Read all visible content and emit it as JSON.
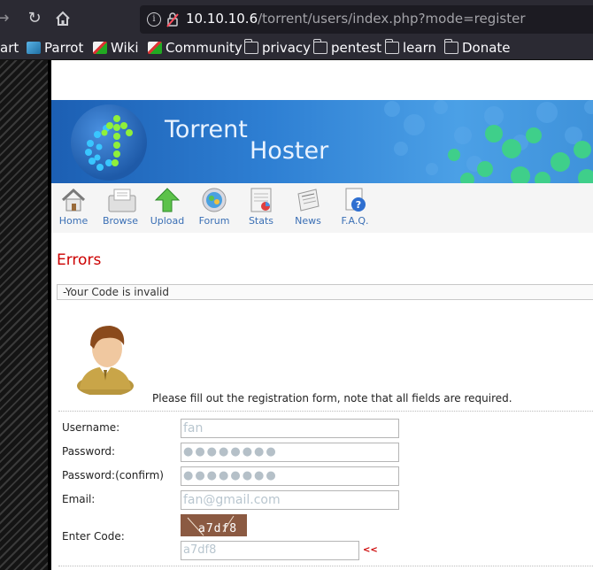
{
  "browser": {
    "url_host": "10.10.10.6",
    "url_path": "/torrent/users/index.php?mode=register",
    "bookmarks": [
      "art",
      "Parrot",
      "Wiki",
      "Community",
      "privacy",
      "pentest",
      "learn",
      "Donate"
    ]
  },
  "site": {
    "title_line1": "Torrent",
    "title_line2": "Hoster",
    "nav": [
      {
        "label": "Home",
        "icon": "home-icon"
      },
      {
        "label": "Browse",
        "icon": "browse-icon"
      },
      {
        "label": "Upload",
        "icon": "upload-icon"
      },
      {
        "label": "Forum",
        "icon": "forum-icon"
      },
      {
        "label": "Stats",
        "icon": "stats-icon"
      },
      {
        "label": "News",
        "icon": "news-icon"
      },
      {
        "label": "F.A.Q.",
        "icon": "faq-icon"
      }
    ]
  },
  "errors": {
    "title": "Errors",
    "message": "-Your Code is invalid"
  },
  "form": {
    "instructions": "Please fill out the registration form, note that all fields are required.",
    "username_label": "Username:",
    "username_value": "fan",
    "password_label": "Password:",
    "password_value": "●●●●●●●●",
    "confirm_label": "Password:(confirm)",
    "confirm_value": "●●●●●●●●",
    "email_label": "Email:",
    "email_value": "fan@gmail.com",
    "code_label": "Enter Code:",
    "captcha_text": "a7df8",
    "code_value": "a7df8",
    "code_marker": "<<"
  },
  "colors": {
    "error_red": "#cc0000",
    "nav_link": "#3a6fb5",
    "banner_blue": "#2e7fd3"
  }
}
